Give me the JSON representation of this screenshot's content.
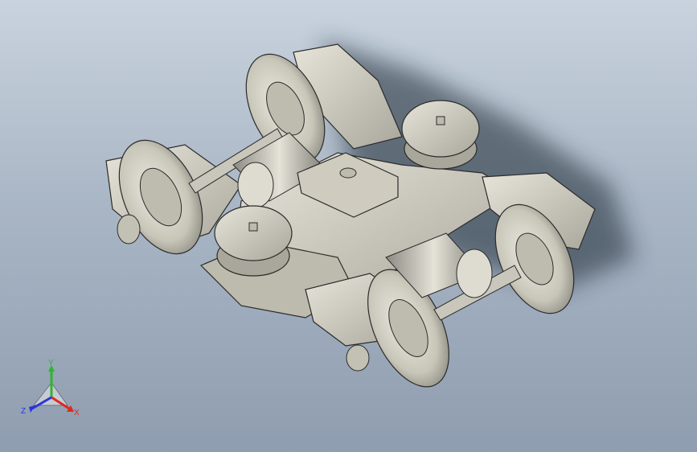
{
  "viewport": {
    "background_top": "#c9d3de",
    "background_bottom": "#8f9db0"
  },
  "model": {
    "part_fill": "#d3d0c3",
    "part_shade": "#9b9a90",
    "edge_color": "#2b2b2b",
    "shadow_color": "#1f2a36"
  },
  "triad": {
    "x_label": "X",
    "y_label": "Y",
    "z_label": "Z",
    "x_color": "#e0291d",
    "y_color": "#2fb52f",
    "z_color": "#2b35d6"
  }
}
